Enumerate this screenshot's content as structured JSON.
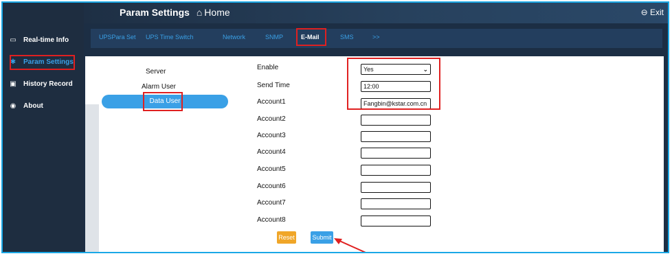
{
  "header": {
    "title": "Param Settings",
    "home_icon": "home-icon",
    "home_label": "Home",
    "exit_label": "Exit",
    "exit_icon": "exit-icon"
  },
  "sidebar": {
    "items": [
      {
        "label": "Real-time Info",
        "icon": "monitor-icon"
      },
      {
        "label": "Param Settings",
        "icon": "gear-icon"
      },
      {
        "label": "History Record",
        "icon": "history-icon"
      },
      {
        "label": "About",
        "icon": "info-icon"
      }
    ]
  },
  "tabs": [
    "UPSPara Set",
    "UPS Time Switch",
    "Network",
    "SNMP",
    "E-Mail",
    "SMS",
    ">>"
  ],
  "subnav": [
    "Server",
    "Alarm User",
    "Data User"
  ],
  "form": {
    "enable_label": "Enable",
    "enable_value": "Yes",
    "send_time_label": "Send Time",
    "send_time_value": "12:00",
    "accounts": [
      {
        "label": "Account1",
        "value": "Fangbin@kstar.com.cn"
      },
      {
        "label": "Account2",
        "value": ""
      },
      {
        "label": "Account3",
        "value": ""
      },
      {
        "label": "Account4",
        "value": ""
      },
      {
        "label": "Account5",
        "value": ""
      },
      {
        "label": "Account6",
        "value": ""
      },
      {
        "label": "Account7",
        "value": ""
      },
      {
        "label": "Account8",
        "value": ""
      }
    ],
    "reset_label": "Reset",
    "submit_label": "Submit"
  },
  "colors": {
    "accent": "#3aa0e6",
    "reset": "#f0a628",
    "highlight": "#e02020",
    "sidebar_bg": "#1e2d40"
  }
}
